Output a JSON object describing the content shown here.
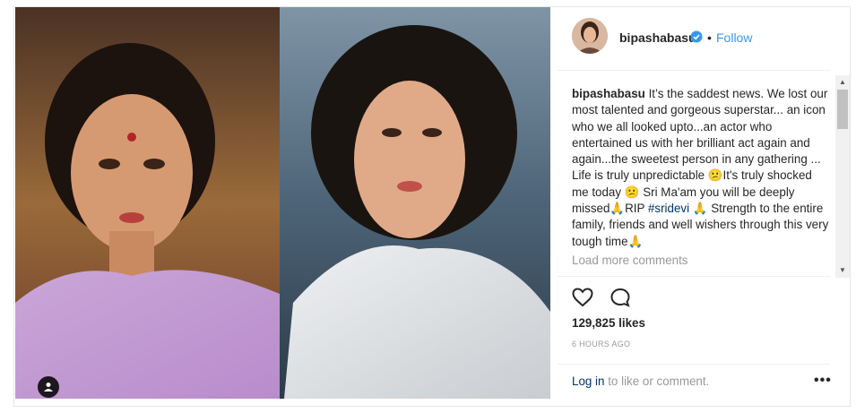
{
  "post": {
    "username": "bipashabasu",
    "dot": "•",
    "follow_label": "Follow",
    "caption_user": "bipashabasu",
    "caption_part1": " It’s the saddest news. We lost our most talented and gorgeous superstar... an icon who we all looked upto...an actor who entertained us with her brilliant act again and again...the sweetest person in any gathering ... Life is truly unpredictable ",
    "emoji_sad1": "😕",
    "caption_part2": "It's truly shocked me today ",
    "emoji_sad2": "😕",
    "caption_part3": " Sri Ma'am you will be deeply missed",
    "emoji_pray1": "🙏",
    "caption_part4": "RIP ",
    "hashtag": "#sridevi",
    "emoji_pray2": " 🙏",
    "caption_part5": " Strength to the entire family, friends and well wishers through this very tough time",
    "emoji_pray3": "🙏",
    "load_more": "Load more comments",
    "likes": "129,825 likes",
    "time": "6 HOURS AGO",
    "login_link": "Log in",
    "login_rest": " to like or comment.",
    "more_label": "•••"
  },
  "icons": {
    "verified_color": "#3897f0",
    "heart": "heart-outline",
    "comment": "speech-bubble-outline",
    "tag": "user-tag"
  }
}
